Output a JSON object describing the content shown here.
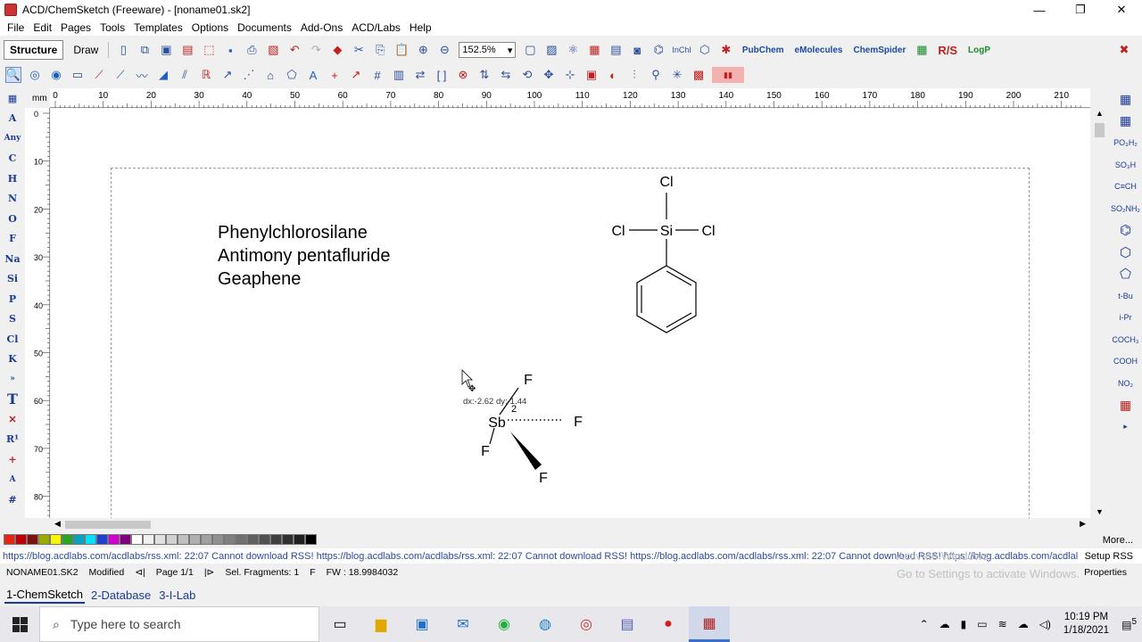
{
  "window": {
    "title": "ACD/ChemSketch (Freeware) - [noname01.sk2]",
    "min": "—",
    "max": "❐",
    "close": "✕"
  },
  "menu": [
    "File",
    "Edit",
    "Pages",
    "Tools",
    "Templates",
    "Options",
    "Documents",
    "Add-Ons",
    "ACD/Labs",
    "Help"
  ],
  "toolbar": {
    "mode_structure": "Structure",
    "mode_draw": "Draw",
    "zoom": "152.5%",
    "links": [
      "PubChem",
      "eMolecules",
      "ChemSpider",
      "R/S",
      "LogP"
    ],
    "inchi": "InChI"
  },
  "left_palette": [
    "A",
    "Any",
    "C",
    "H",
    "N",
    "O",
    "F",
    "Na",
    "Si",
    "P",
    "S",
    "Cl",
    "K",
    "T",
    "R¹",
    "+",
    "#"
  ],
  "right_palette": [
    "PO₃H₂",
    "SO₃H",
    "C≡CH",
    "SO₂NH₂",
    "t-Bu",
    "i-Pr",
    "COCH₃",
    "COOH",
    "NO₂"
  ],
  "ruler": {
    "unit": "mm",
    "top_ticks": [
      "0",
      "10",
      "20",
      "30",
      "40",
      "50",
      "60",
      "70",
      "80",
      "90",
      "100",
      "110",
      "120",
      "130",
      "140",
      "150",
      "160",
      "170",
      "180",
      "190",
      "200",
      "210"
    ],
    "left_ticks": [
      "0",
      "10",
      "20",
      "30",
      "40",
      "50",
      "60",
      "70",
      "80"
    ]
  },
  "canvas": {
    "names": [
      "Phenylchlorosilane",
      "Antimony pentafluride",
      "Geaphene"
    ],
    "silane": {
      "center": "Si",
      "sub_top": "Cl",
      "sub_left": "Cl",
      "sub_right": "Cl"
    },
    "sbf5": {
      "center": "Sb",
      "f1": "F",
      "f2": "F",
      "f3": "F",
      "f4": "F",
      "cursor_label": "dx:-2.62 dy:-1.44",
      "charge": "2"
    }
  },
  "colors": [
    "#e8231a",
    "#c00000",
    "#7f1010",
    "#9aaa00",
    "#f7f700",
    "#2aa52a",
    "#0aa0c0",
    "#00e0ff",
    "#2040d0",
    "#d000d0",
    "#800080",
    "#ffffff",
    "#f0f0f0",
    "#e0e0e0",
    "#d0d0d0",
    "#c0c0c0",
    "#b0b0b0",
    "#a0a0a0",
    "#909090",
    "#808080",
    "#707070",
    "#606060",
    "#505050",
    "#404040",
    "#303030",
    "#202020",
    "#000000"
  ],
  "more_label": "More...",
  "rss": {
    "text": "https://blog.acdlabs.com/acdlabs/rss.xml: 22:07 Cannot download RSS!  https://blog.acdlabs.com/acdlabs/rss.xml: 22:07 Cannot download RSS!  https://blog.acdlabs.com/acdlabs/rss.xml: 22:07 Cannot download RSS!  https://blog.acdlabs.com/acdlal",
    "setup": "Setup RSS"
  },
  "status": {
    "file": "NONAME01.SK2",
    "state": "Modified",
    "page": "Page 1/1",
    "sel": "Sel. Fragments: 1",
    "atom": "F",
    "fw": "FW : 18.9984032",
    "properties": "Properties"
  },
  "watermark": [
    "Activate Windows",
    "Go to Settings to activate Windows."
  ],
  "app_tabs": [
    "1-ChemSketch",
    "2-Database",
    "3-I-Lab"
  ],
  "taskbar": {
    "search_placeholder": "Type here to search",
    "time": "10:19 PM",
    "date": "1/18/2021",
    "notif_count": "5"
  }
}
